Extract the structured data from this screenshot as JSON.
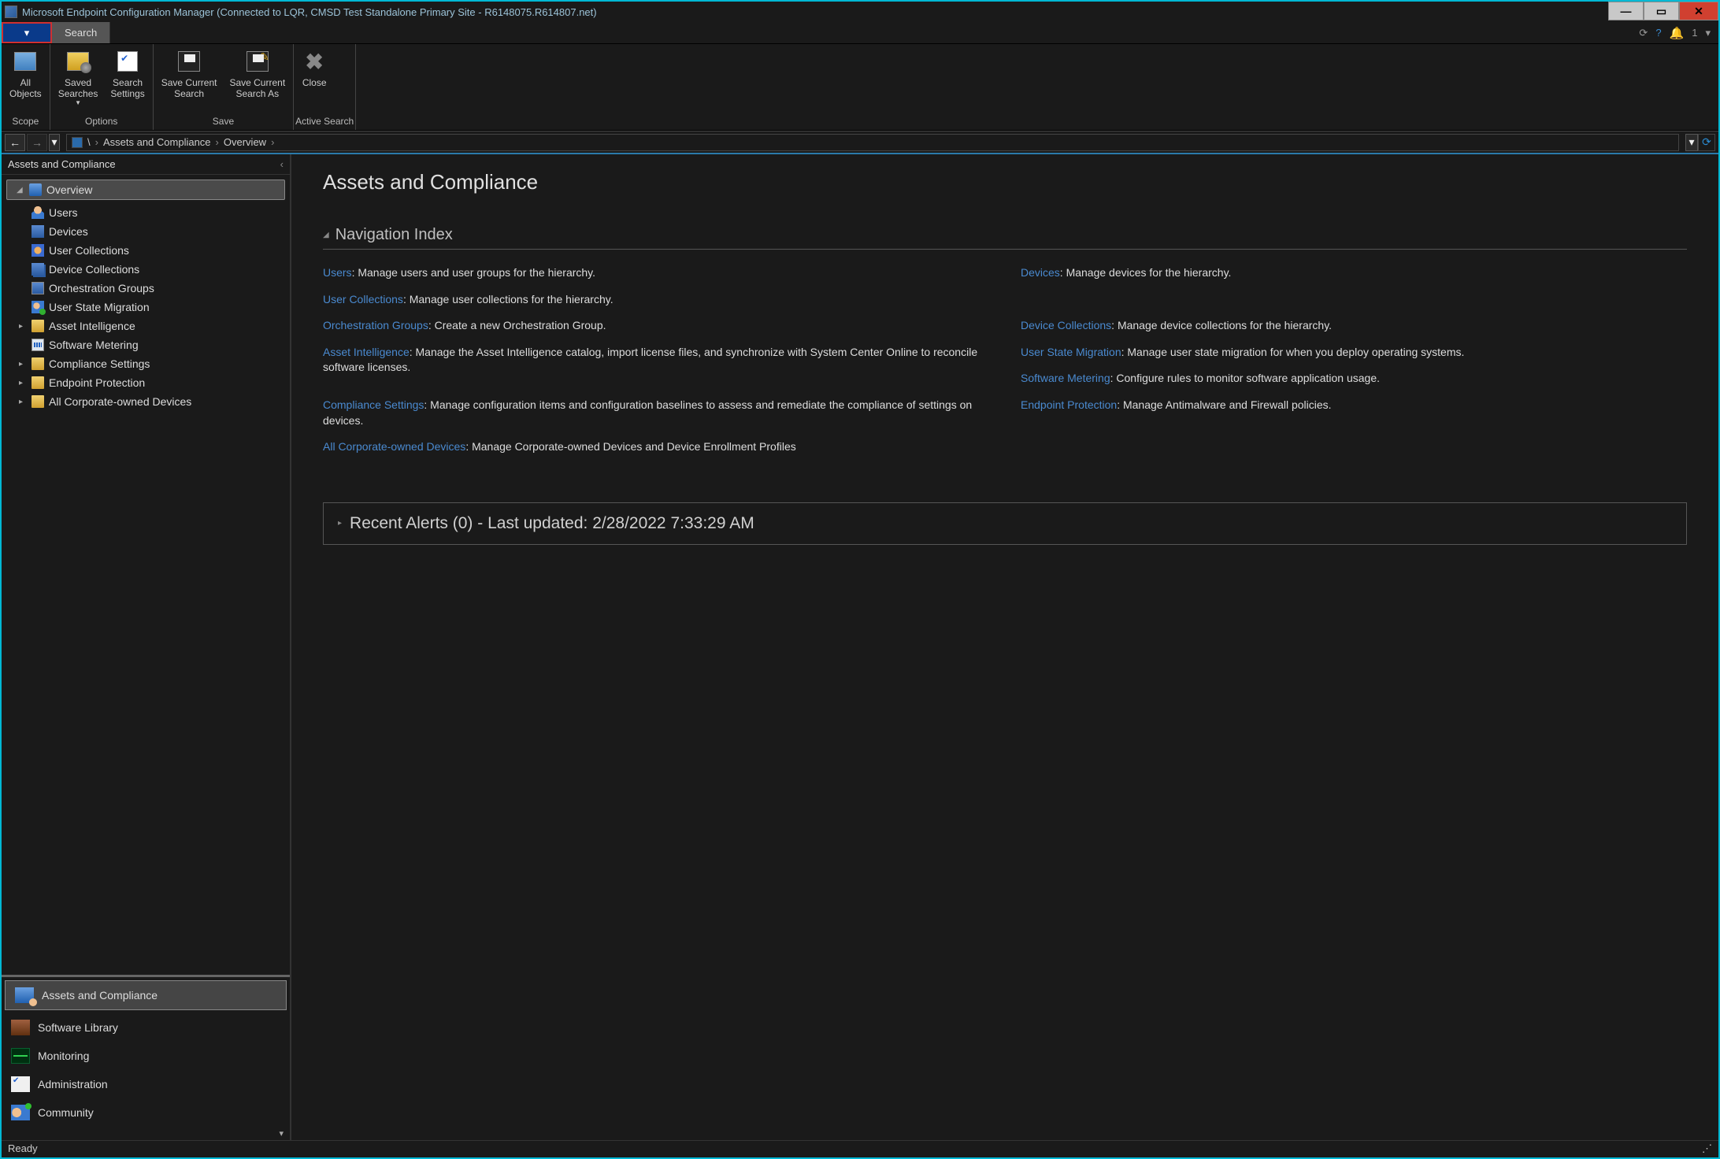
{
  "titlebar": {
    "title": "Microsoft Endpoint Configuration Manager (Connected to LQR, CMSD Test Standalone Primary Site - R6148075.R614807.net)"
  },
  "menubar": {
    "search_tab": "Search",
    "notifications_count": "1"
  },
  "ribbon": {
    "scope": {
      "all_objects": "All\nObjects",
      "group_label": "Scope"
    },
    "options": {
      "saved_searches": "Saved\nSearches",
      "search_settings": "Search\nSettings",
      "group_label": "Options"
    },
    "save": {
      "save_current": "Save Current\nSearch",
      "save_as": "Save Current\nSearch As",
      "group_label": "Save"
    },
    "active_search": {
      "close": "Close",
      "group_label": "Active Search"
    }
  },
  "breadcrumb": {
    "root": "\\",
    "seg1": "Assets and Compliance",
    "seg2": "Overview"
  },
  "sidebar": {
    "header": "Assets and Compliance",
    "tree": {
      "overview": "Overview",
      "users": "Users",
      "devices": "Devices",
      "user_collections": "User Collections",
      "device_collections": "Device Collections",
      "orchestration_groups": "Orchestration Groups",
      "user_state_migration": "User State Migration",
      "asset_intelligence": "Asset Intelligence",
      "software_metering": "Software Metering",
      "compliance_settings": "Compliance Settings",
      "endpoint_protection": "Endpoint Protection",
      "all_corporate_devices": "All Corporate-owned Devices"
    },
    "wunderbar": {
      "assets": "Assets and Compliance",
      "library": "Software Library",
      "monitoring": "Monitoring",
      "administration": "Administration",
      "community": "Community"
    }
  },
  "main": {
    "title": "Assets and Compliance",
    "nav_index": "Navigation Index",
    "entries": {
      "users": {
        "link": "Users",
        "desc": ": Manage users and user groups for the hierarchy."
      },
      "devices": {
        "link": "Devices",
        "desc": ": Manage devices for the hierarchy."
      },
      "user_collections": {
        "link": "User Collections",
        "desc": ": Manage user collections for the hierarchy."
      },
      "device_collections": {
        "link": "Device Collections",
        "desc": ": Manage device collections for the hierarchy."
      },
      "orchestration": {
        "link": "Orchestration Groups",
        "desc": ": Create a new Orchestration Group."
      },
      "user_state": {
        "link": "User State Migration",
        "desc": ": Manage user state migration for when you deploy operating systems."
      },
      "asset_intel": {
        "link": "Asset Intelligence",
        "desc": ": Manage the Asset Intelligence catalog, import license files, and synchronize with System Center Online to reconcile software licenses."
      },
      "software_metering": {
        "link": "Software Metering",
        "desc": ": Configure rules to monitor software application usage."
      },
      "compliance": {
        "link": "Compliance Settings",
        "desc": ": Manage configuration items and configuration baselines to assess and remediate the compliance of settings on devices."
      },
      "endpoint": {
        "link": "Endpoint Protection",
        "desc": ": Manage Antimalware and Firewall policies."
      },
      "corp_devices": {
        "link": "All Corporate-owned Devices",
        "desc": ": Manage Corporate-owned Devices and Device Enrollment Profiles"
      }
    },
    "recent_alerts": "Recent Alerts (0) - Last updated: 2/28/2022 7:33:29 AM"
  },
  "statusbar": {
    "text": "Ready"
  }
}
